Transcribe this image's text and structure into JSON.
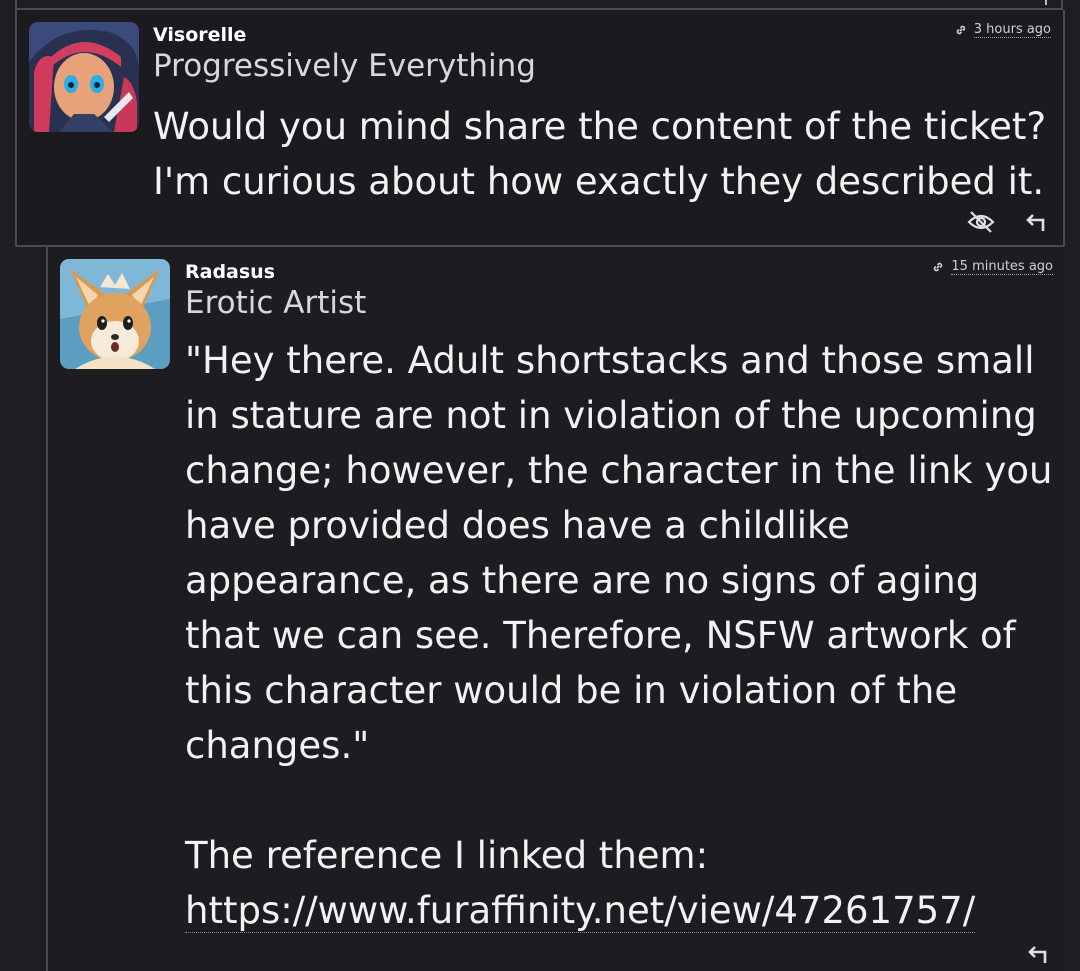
{
  "comments": [
    {
      "username": "Visorelle",
      "user_title": "Progressively Everything",
      "time": "3 hours ago",
      "body": "Would you mind share the content of the ticket?\nI'm curious about how exactly they described it."
    },
    {
      "username": "Radasus",
      "user_title": "Erotic Artist",
      "time": "15 minutes ago",
      "body": "\"Hey there. Adult shortstacks and those small\nin stature are not in violation of the upcoming\nchange; however, the character in the link you\nhave provided does have a childlike\nappearance, as there are no signs of aging\nthat we can see. Therefore, NSFW artwork of\nthis character would be in violation of the\nchanges.\"\n\nThe reference I linked them:",
      "link": "https://www.furaffinity.net/view/47261757/"
    }
  ],
  "icons": {
    "permalink": "link-icon",
    "hide": "eye-off-icon",
    "reply": "reply-arrow-icon"
  }
}
